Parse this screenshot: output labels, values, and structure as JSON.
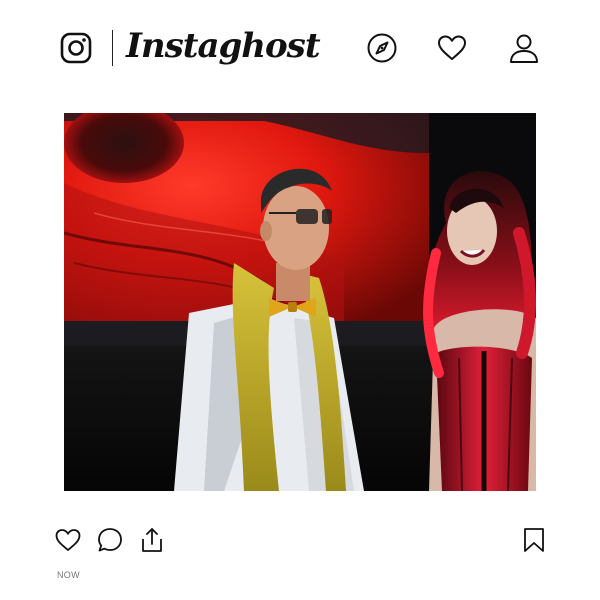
{
  "header": {
    "brand_name": "Instaghost",
    "icons": {
      "logo": "instagram-logo-icon",
      "explore": "compass-icon",
      "activity": "heart-icon",
      "profile": "user-icon"
    }
  },
  "post": {
    "image_description_icon": "photo",
    "actions": {
      "like": "heart-outline-icon",
      "comment": "speech-bubble-icon",
      "share": "share-upload-icon",
      "save": "bookmark-icon"
    },
    "timestamp": "NOW"
  },
  "colors": {
    "icon": "#111111",
    "background": "#ffffff",
    "timestamp": "#777777"
  }
}
